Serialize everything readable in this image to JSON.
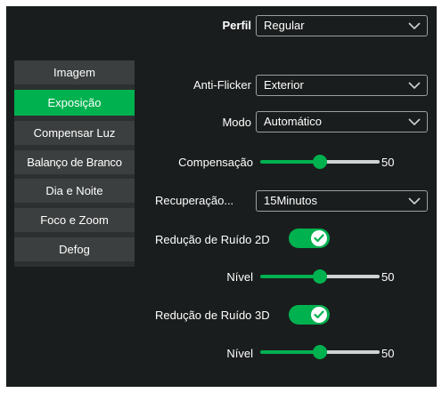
{
  "profile": {
    "label": "Perfil",
    "value": "Regular"
  },
  "sidebar": {
    "items": [
      {
        "label": "Imagem",
        "active": false
      },
      {
        "label": "Exposição",
        "active": true
      },
      {
        "label": "Compensar Luz",
        "active": false
      },
      {
        "label": "Balanço de Branco",
        "active": false
      },
      {
        "label": "Dia e Noite",
        "active": false
      },
      {
        "label": "Foco e Zoom",
        "active": false
      },
      {
        "label": "Defog",
        "active": false
      }
    ]
  },
  "settings": {
    "anti_flicker": {
      "label": "Anti-Flicker",
      "value": "Exterior"
    },
    "mode": {
      "label": "Modo",
      "value": "Automático"
    },
    "compensation": {
      "label": "Compensação",
      "value": "50",
      "level": 0.5
    },
    "recovery": {
      "label": "Recuperação...",
      "value": "15Minutos"
    },
    "nr2d": {
      "label": "Redução de Ruído 2D",
      "enabled": true
    },
    "nr2d_level": {
      "label": "Nível",
      "value": "50",
      "level": 0.5
    },
    "nr3d": {
      "label": "Redução de Ruído 3D",
      "enabled": true
    },
    "nr3d_level": {
      "label": "Nível",
      "value": "50",
      "level": 0.5
    }
  },
  "icons": {
    "dropdown": "chevron-down-icon",
    "toggle_on": "check-icon"
  },
  "colors": {
    "background": "#1a1d1d",
    "accent": "#00b14f",
    "nav_item": "#3c3f3f",
    "track": "#cfd3d3"
  }
}
